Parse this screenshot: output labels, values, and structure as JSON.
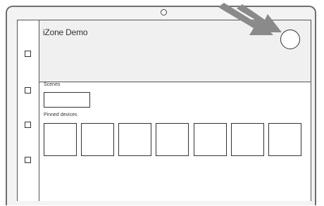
{
  "header": {
    "title": "iZone Demo"
  },
  "sections": {
    "scenes_label": "Scenes",
    "pinned_label": "Pinned devices"
  },
  "sidebar": {
    "items": [
      "item-1",
      "item-2",
      "item-3",
      "item-4"
    ]
  },
  "scenes": {
    "count": 1
  },
  "pinned_devices": {
    "count": 7
  },
  "colors": {
    "frame": "#6f6f6f",
    "header_bg": "#f0f0f0",
    "annotation_arrow": "#8a8a8a"
  }
}
